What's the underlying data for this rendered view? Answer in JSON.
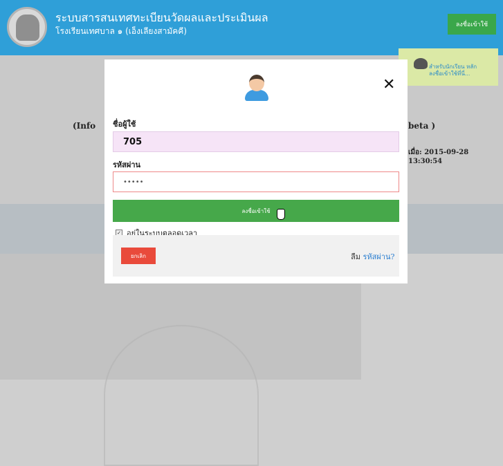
{
  "header": {
    "title": "ระบบสารสนเทศทะเบียนวัดผลและประเมินผล",
    "subtitle": "โรงเรียนเทศบาล ๑ (เอ็งเลียงสามัคคี)",
    "login_button": "ลงชื่อเข้าใช้"
  },
  "student_box": {
    "text_line1": "สำหรับนักเรียน หลัก",
    "text_line2": "ลงชื่อเข้าใช้ที่นี่..."
  },
  "background": {
    "info_left": "(Info",
    "info_right": "beta )",
    "date_text": "เมื่อ: 2015-09-28 13:30:54"
  },
  "modal": {
    "username_label": "ชื่อผู้ใช้",
    "username_value": "705",
    "password_label": "รหัสผ่าน",
    "password_value": "•••••",
    "login_button": "ลงชื่อเข้าใช้",
    "remember_label": "อยู่ในระบบตลอดเวลา",
    "remember_checked": true,
    "cancel_button": "ยกเลิก",
    "forgot_prefix": "ลืม",
    "forgot_link": "รหัสผ่าน?"
  },
  "icons": {
    "close": "close-icon",
    "avatar": "user-avatar-icon",
    "logo": "school-logo-icon",
    "cursor": "hand-cursor-icon"
  },
  "colors": {
    "header_blue": "#2f9fd8",
    "login_green": "#46a84a",
    "cancel_red": "#e94a3b",
    "username_bg": "#f6e4f7",
    "link_blue": "#2c7fd0"
  }
}
